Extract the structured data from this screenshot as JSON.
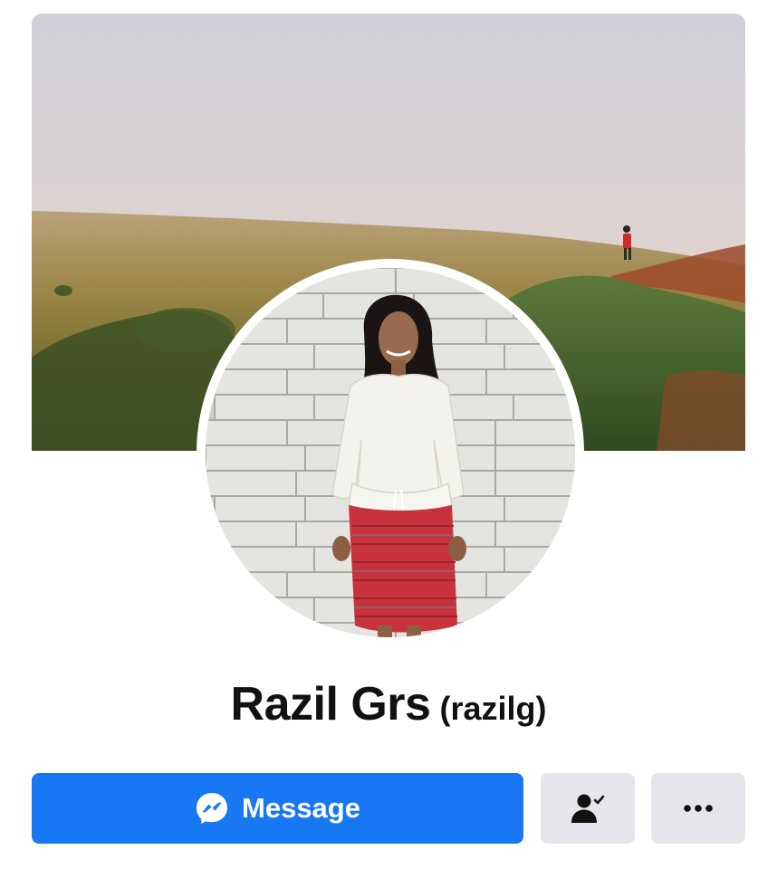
{
  "profile": {
    "display_name": "Razil Grs",
    "username": "(razilg)"
  },
  "actions": {
    "message_label": "Message",
    "message_icon": "messenger-icon",
    "friends_icon": "person-check-icon",
    "more_icon": "more-dots-icon"
  },
  "colors": {
    "primary": "#1877f2",
    "secondary_button": "#e4e6eb",
    "text": "#111111"
  }
}
